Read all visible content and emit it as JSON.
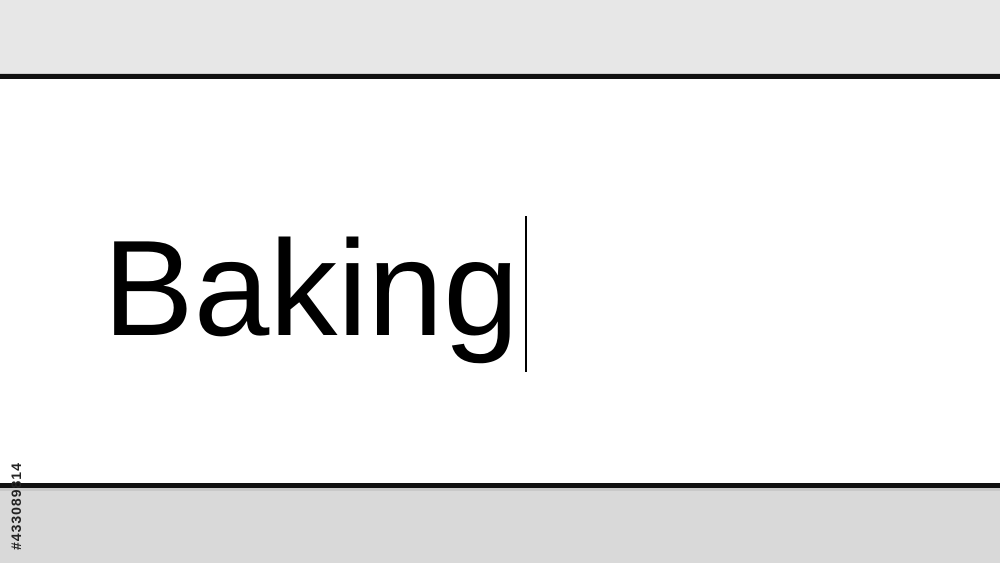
{
  "search": {
    "query": "Baking"
  },
  "watermark": {
    "stock_id": "#433089814"
  },
  "colors": {
    "background_band_top": "#e7e7e7",
    "background_band_bottom": "#d9d9d9",
    "field_background": "#ffffff",
    "field_border": "#111111",
    "text": "#000000"
  }
}
